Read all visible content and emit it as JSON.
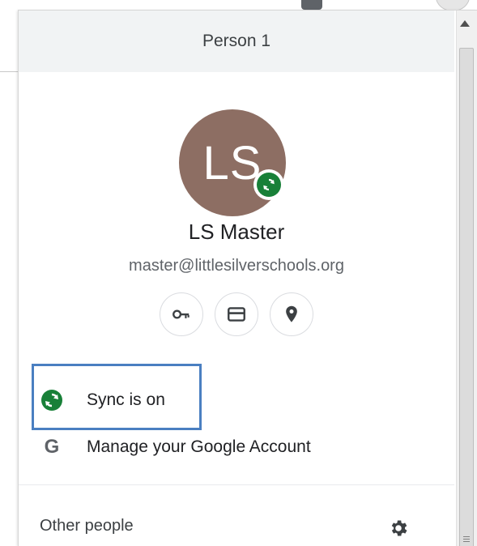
{
  "profile_menu": {
    "header_title": "Person 1",
    "avatar_initials": "LS",
    "avatar_color": "#8d6e63",
    "sync_badge_color": "#188038",
    "name": "LS Master",
    "email": "master@littlesilverschools.org",
    "quick_actions": [
      {
        "icon": "key-icon"
      },
      {
        "icon": "payment-card-icon"
      },
      {
        "icon": "location-pin-icon"
      }
    ],
    "sync_status": "Sync is on",
    "manage_account": "Manage your Google Account",
    "google_letter": "G",
    "other_people": "Other people",
    "highlight_color": "#4a7fc1"
  }
}
